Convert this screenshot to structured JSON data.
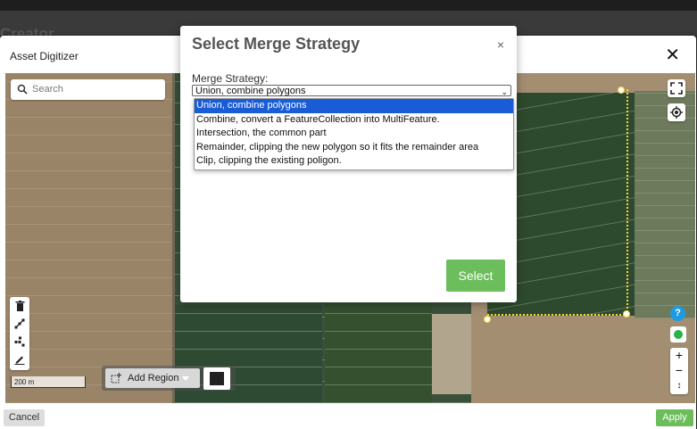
{
  "background": {
    "title": "Creator"
  },
  "outer_modal": {
    "title": "Asset Digitizer",
    "close_icon": "close-icon",
    "cancel_label": "Cancel",
    "apply_label": "Apply"
  },
  "map": {
    "search_placeholder": "Search",
    "scale_label": "200 m",
    "add_region_label": "Add Region",
    "help_label": "?",
    "zoom_in_label": "+",
    "zoom_out_label": "−",
    "compass_label": "↕",
    "swatch_color": "#222222",
    "polygon_color": "#f4d23d"
  },
  "dialog": {
    "title": "Select Merge Strategy",
    "close_label": "×",
    "field_label": "Merge Strategy:",
    "selected_value": "Union, combine polygons",
    "options": [
      "Union, combine polygons",
      "Combine, convert a FeatureCollection into MultiFeature.",
      "Intersection, the common part",
      "Remainder, clipping the new polygon so it fits the remainder area",
      "Clip, clipping the existing poligon."
    ],
    "select_button_label": "Select",
    "accent_color": "#6cbd5b",
    "highlight_color": "#1a5bd6"
  }
}
